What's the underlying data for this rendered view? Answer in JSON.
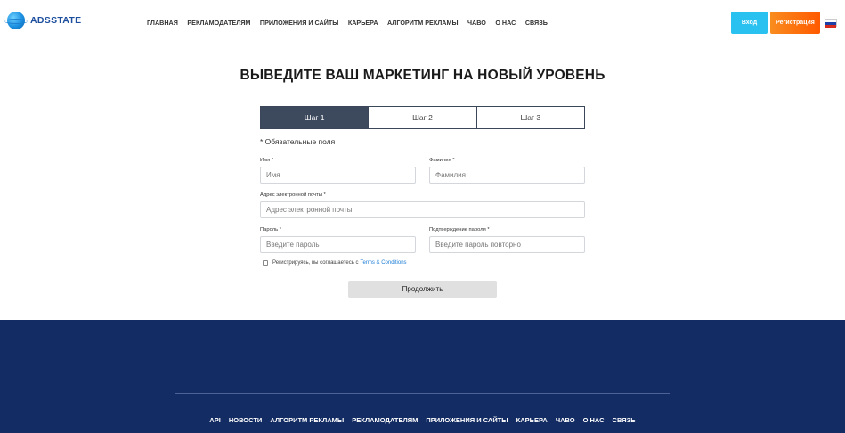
{
  "header": {
    "logo_text": "ADSSTATE",
    "nav": [
      "ГЛАВНАЯ",
      "РЕКЛАМОДАТЕЛЯМ",
      "ПРИЛОЖЕНИЯ И САЙТЫ",
      "КАРЬЕРА",
      "АЛГОРИТМ РЕКЛАМЫ",
      "ЧАВО",
      "О НАС",
      "СВЯЗЬ"
    ],
    "login_label": "Вход",
    "register_label": "Регистрация",
    "language_icon": "russian-flag-icon"
  },
  "main": {
    "title": "ВЫВЕДИТЕ ВАШ МАРКЕТИНГ НА НОВЫЙ УРОВЕНЬ",
    "steps": [
      "Шаг 1",
      "Шаг 2",
      "Шаг 3"
    ],
    "active_step": "Шаг 1",
    "required_note": "* Обязательные поля",
    "form": {
      "first_name": {
        "label": "Имя *",
        "placeholder": "Имя"
      },
      "last_name": {
        "label": "Фамилия *",
        "placeholder": "Фамилия"
      },
      "email": {
        "label": "Адрес электронной почты *",
        "placeholder": "Адрес электронной почты"
      },
      "password": {
        "label": "Пароль *",
        "placeholder": "Введите пароль"
      },
      "password_confirm": {
        "label": "Подтверждение пароля *",
        "placeholder": "Введите пароль повторно"
      },
      "terms_text": "Регистрируясь, вы соглашаетесь с",
      "terms_link": "Terms & Conditions",
      "continue_label": "Продолжить"
    }
  },
  "footer": {
    "nav": [
      "API",
      "НОВОСТИ",
      "АЛГОРИТМ РЕКЛАМЫ",
      "РЕКЛАМОДАТЕЛЯМ",
      "ПРИЛОЖЕНИЯ И САЙТЫ",
      "КАРЬЕРА",
      "ЧАВО",
      "О НАС",
      "СВЯЗЬ"
    ]
  },
  "colors": {
    "accent_blue": "#29c2f0",
    "accent_orange": "#ff6a00",
    "step_active": "#3d4a5e",
    "footer_bg": "#132c63"
  }
}
